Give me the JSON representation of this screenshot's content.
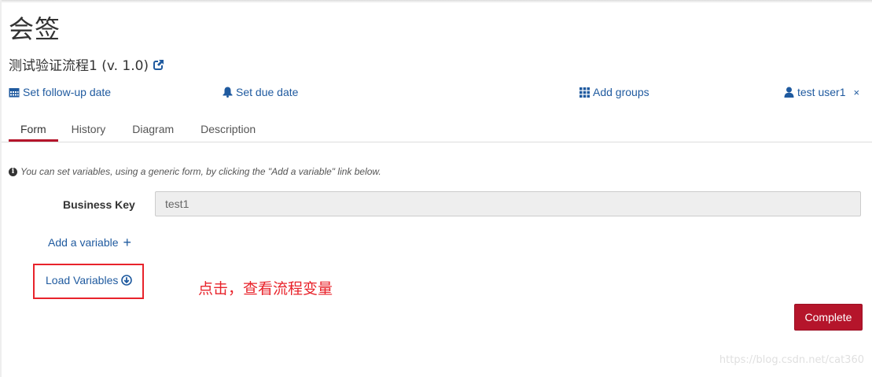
{
  "header": {
    "title": "会签",
    "process_name": "测试验证流程1 (v. 1.0)"
  },
  "meta": {
    "follow_up_label": "Set follow-up date",
    "due_date_label": "Set due date",
    "add_groups_label": "Add groups",
    "assignee_label": "test user1",
    "remove_assignee": "×"
  },
  "tabs": [
    {
      "label": "Form",
      "active": true
    },
    {
      "label": "History",
      "active": false
    },
    {
      "label": "Diagram",
      "active": false
    },
    {
      "label": "Description",
      "active": false
    }
  ],
  "form": {
    "info_text": "You can set variables, using a generic form, by clicking the \"Add a variable\" link below.",
    "business_key_label": "Business Key",
    "business_key_value": "test1",
    "add_variable_label": "Add a variable",
    "add_variable_icon": "+",
    "load_variables_label": "Load Variables",
    "complete_label": "Complete"
  },
  "annotation": {
    "text": "点击，查看流程变量",
    "color": "#e8232b"
  },
  "watermark": "https://blog.csdn.net/cat360",
  "colors": {
    "link": "#1f5a9f",
    "accent": "#b5152b"
  }
}
